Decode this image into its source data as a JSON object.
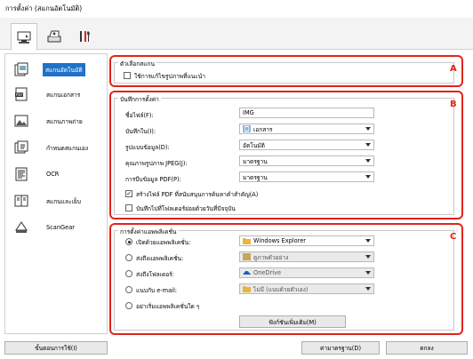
{
  "window": {
    "title": "การตั้งค่า (สแกนอัตโนมัติ)"
  },
  "toolbar": {
    "tabs": [
      {
        "name": "scan-from-computer-tab",
        "icon": "computer-scan-icon",
        "active": true
      },
      {
        "name": "scan-from-operation-panel-tab",
        "icon": "scanner-panel-icon",
        "active": false
      },
      {
        "name": "general-settings-tab",
        "icon": "tools-icon",
        "active": false
      }
    ]
  },
  "sidebar": {
    "items": [
      {
        "label": "สแกนอัตโนมัติ",
        "icon": "auto-scan-icon",
        "active": true
      },
      {
        "label": "สแกนเอกสาร",
        "icon": "pdf-document-icon",
        "active": false
      },
      {
        "label": "สแกนภาพถ่าย",
        "icon": "photo-icon",
        "active": false
      },
      {
        "label": "กำหนดสแกนเอง",
        "icon": "custom-scan-icon",
        "active": false
      },
      {
        "label": "OCR",
        "icon": "ocr-icon",
        "active": false
      },
      {
        "label": "สแกนและเย็บ",
        "icon": "stitch-icon",
        "active": false
      },
      {
        "label": "ScanGear",
        "icon": "scangear-icon",
        "active": false
      }
    ]
  },
  "scan_options": {
    "title": "ตัวเลือกสแกน",
    "marker": "A",
    "apply_correction_label": "ใช้การแก้ไขรูปภาพที่แนะนำ",
    "apply_correction_checked": false
  },
  "save_settings": {
    "title": "บันทึกการตั้งค่า",
    "marker": "B",
    "file_name_label": "ชื่อไฟล์(F):",
    "file_name_value": "IMG",
    "save_in_label": "บันทึกใน(I):",
    "save_in_value": "เอกสาร",
    "data_format_label": "รูปแบบข้อมูล(D):",
    "data_format_value": "อัตโนมัติ",
    "jpeg_quality_label": "คุณภาพรูปภาพ JPEG(J):",
    "jpeg_quality_value": "มาตรฐาน",
    "pdf_compression_label": "การบีบข้อมูล PDF(P):",
    "pdf_compression_value": "มาตรฐาน",
    "searchable_pdf_label": "สร้างไฟล์ PDF ที่สนับสนุนการค้นหาคำสำคัญ(A)",
    "searchable_pdf_checked": true,
    "subfolder_label": "บันทึกไปที่โฟลเดอร์ย่อยด้วยวันที่ปัจจุบัน",
    "subfolder_checked": false
  },
  "app_settings": {
    "title": "การตั้งค่าแอพพลิเคชั่น",
    "marker": "C",
    "open_with_label": "เปิดด้วยแอพพลิเคชั่น:",
    "open_with_value": "Windows Explorer",
    "send_to_app_label": "ส่งถึงแอพพลิเคชั่น:",
    "send_to_app_value": "ดูภาพตัวอย่าง",
    "send_to_folder_label": "ส่งถึงโฟลเดอร์:",
    "send_to_folder_value": "OneDrive",
    "attach_email_label": "แนบกับ e-mail:",
    "attach_email_value": "ไม่มี (แนบด้วยตัวเอง)",
    "no_app_label": "อย่าเริ่มแอพพลิเคชั่นใด ๆ",
    "more_functions_label": "ฟังก์ชันเพิ่มเติม(M)",
    "selected_option": "open_with"
  },
  "footer": {
    "instructions_label": "ขั้นตอนการใช้(I)",
    "defaults_label": "ค่ามาตรฐาน(D)",
    "ok_label": "ตกลง"
  },
  "colors": {
    "accent": "#1f73c7",
    "marker": "#e2231a"
  }
}
